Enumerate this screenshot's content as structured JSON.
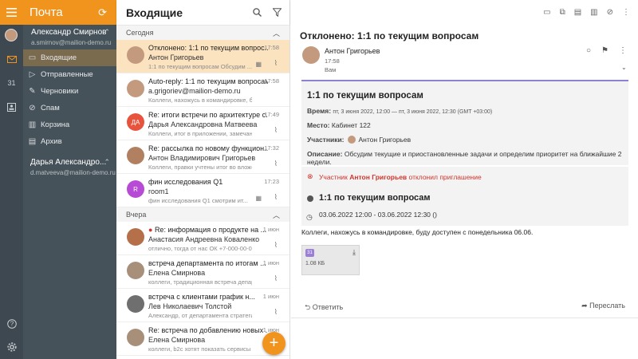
{
  "app": {
    "title": "Почта"
  },
  "accounts": [
    {
      "name": "Александр Смирнов",
      "email": "a.smirnov@mailion-demo.ru"
    },
    {
      "name": "Дарья Александро...",
      "email": "d.matveeva@mailion-demo.ru"
    }
  ],
  "folders": [
    {
      "label": "Входящие",
      "icon": "inbox-icon"
    },
    {
      "label": "Отправленные",
      "icon": "send-icon"
    },
    {
      "label": "Черновики",
      "icon": "pencil-icon"
    },
    {
      "label": "Спам",
      "icon": "spam-icon"
    },
    {
      "label": "Корзина",
      "icon": "trash-icon"
    },
    {
      "label": "Архив",
      "icon": "archive-icon"
    }
  ],
  "list": {
    "title": "Входящие",
    "groups": [
      {
        "label": "Сегодня"
      },
      {
        "label": "Вчера"
      }
    ],
    "messages": [
      {
        "subject": "Отклонено: 1:1 по текущим вопрос...",
        "from": "Антон Григорьев",
        "preview": "1:1 по текущим вопросам Обсудим ...",
        "time": "17:58",
        "avatar": "",
        "color": "#c49a7e"
      },
      {
        "subject": "Auto-reply: 1:1 по текущим вопросам",
        "from": "a.grigoriev@mailion-demo.ru",
        "preview": "Коллеги, нахожусь в командировке, буду доступ...",
        "time": "17:58",
        "avatar": "",
        "color": "#c49a7e"
      },
      {
        "subject": "Re: итоги встречи по архитектуре с...",
        "from": "Дарья Александровна Матвеева",
        "preview": "Коллеги, итог в приложении, замечания к ...",
        "time": "17:49",
        "avatar": "ДА",
        "color": "#e8533d"
      },
      {
        "subject": "Re: рассылка по новому функцион...",
        "from": "Антон Владимирович Григорьев",
        "preview": "Коллеги, правки учтены итог во вложени...",
        "time": "17:32",
        "avatar": "",
        "color": "#b08060"
      },
      {
        "subject": "фин исследования Q1",
        "from": "room1",
        "preview": "фин исследования Q1 смотрим ит...",
        "time": "17:23",
        "avatar": "R",
        "color": "#b84bd6"
      },
      {
        "subject": "Re: информация о продукте на ...",
        "from": "Анастасия Андреевна Коваленко",
        "preview": "отлично, тогда от нас ОК +7-000-00-00 доб...",
        "time": "1 июн",
        "avatar": "",
        "color": "#b5704a"
      },
      {
        "subject": "встреча департамента по итогам ...",
        "from": "Елена Смирнова",
        "preview": "коллеги, традиционная встреча департам...",
        "time": "1 июн",
        "avatar": "",
        "color": "#a88f7a"
      },
      {
        "subject": "встреча с клиентами график н...",
        "from": "Лев Николаевич Толстой",
        "preview": "Александр, от департамента стратегичес...",
        "time": "1 июн",
        "avatar": "",
        "color": "#6f6f6f"
      },
      {
        "subject": "Re: встреча по добавлению новых ...",
        "from": "Елена Смирнова",
        "preview": "коллеги, b2c хотят показать сервисы кал...",
        "time": "1 июн",
        "avatar": "",
        "color": "#a88f7a"
      }
    ]
  },
  "reader": {
    "title": "Отклонено: 1:1 по текущим вопросам",
    "sender": "Антон Григорьев",
    "time": "17:58",
    "to": "Вам",
    "invite": {
      "heading": "1:1 по текущим вопросам",
      "time_label": "Время:",
      "time_value": "пт, 3 июня 2022, 12:00 — пт, 3 июня 2022, 12:30 (GMT +03:00)",
      "place_label": "Место:",
      "place_value": "Кабинет 122",
      "participants_label": "Участники:",
      "participant": "Антон Григорьев",
      "desc_label": "Описание:",
      "desc_value": "Обсудим текущие и приостановленные задачи и определим приоритет на ближайшие 2 недели."
    },
    "decline": {
      "prefix": "Участник",
      "who": "Антон Григорьев",
      "suffix": "отклонил приглашение",
      "event": "1:1 по текущим вопросам",
      "datetime": "03.06.2022 12:00 - 03.06.2022 12:30 ()"
    },
    "body": "Коллеги, нахожусь в командировке, буду доступен с понедельника 06.06.",
    "attachment": {
      "icon_text": "31",
      "size": "1.08 КБ"
    },
    "reply": "Ответить",
    "forward": "Переслать"
  },
  "colors": {
    "accent": "#f0941e",
    "rail": "#3d4850",
    "sidebar": "#46525a",
    "selected": "#fce3c0",
    "decline": "#d1342b"
  }
}
